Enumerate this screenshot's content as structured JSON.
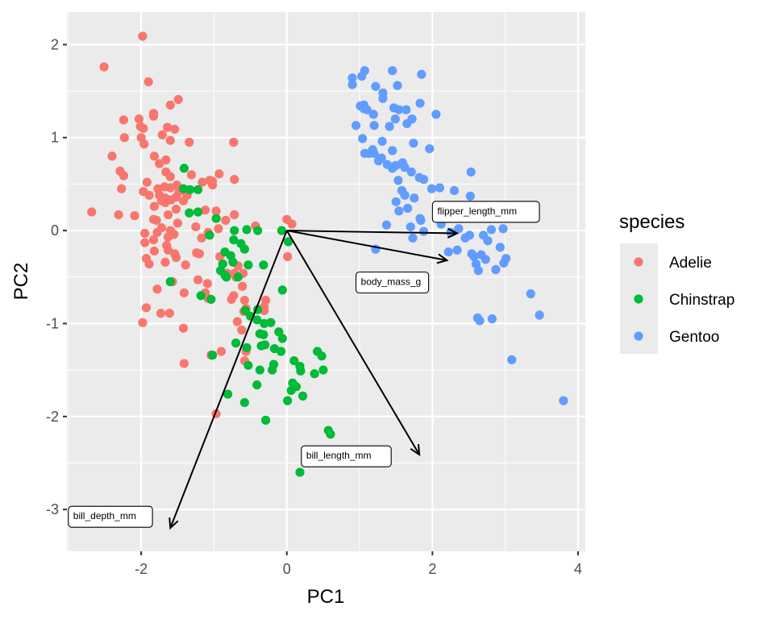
{
  "chart_data": {
    "type": "scatter",
    "title": "",
    "xlabel": "PC1",
    "ylabel": "PC2",
    "xlim": [
      -3.02,
      4.1
    ],
    "ylim": [
      -3.45,
      2.35
    ],
    "x_ticks": [
      -2,
      0,
      2,
      4
    ],
    "y_ticks": [
      -3,
      -2,
      -1,
      0,
      1,
      2
    ],
    "grid": true,
    "legend": {
      "title": "species",
      "position": "right"
    },
    "series": [
      {
        "name": "Adelie",
        "color": "#F8766D",
        "points": [
          [
            -1.98,
            2.09
          ],
          [
            -2.51,
            1.76
          ],
          [
            -1.9,
            1.6
          ],
          [
            -1.6,
            1.35
          ],
          [
            -1.49,
            1.41
          ],
          [
            -1.83,
            1.26
          ],
          [
            -1.83,
            1.23
          ],
          [
            -2.03,
            1.2
          ],
          [
            -2.24,
            1.19
          ],
          [
            -2.01,
            1.12
          ],
          [
            -1.97,
            1.1
          ],
          [
            -2.23,
            1.0
          ],
          [
            -2.0,
            1.0
          ],
          [
            -1.64,
            1.11
          ],
          [
            -1.54,
            1.09
          ],
          [
            -1.71,
            1.03
          ],
          [
            -1.6,
            0.97
          ],
          [
            -1.34,
            0.95
          ],
          [
            -0.73,
            0.95
          ],
          [
            -1.96,
            0.93
          ],
          [
            -1.82,
            0.8
          ],
          [
            -1.66,
            0.76
          ],
          [
            -2.4,
            0.8
          ],
          [
            -1.75,
            0.72
          ],
          [
            -2.29,
            0.64
          ],
          [
            -2.24,
            0.59
          ],
          [
            -1.66,
            0.63
          ],
          [
            -1.6,
            0.58
          ],
          [
            -1.92,
            0.52
          ],
          [
            -2.27,
            0.45
          ],
          [
            -1.97,
            0.42
          ],
          [
            -1.77,
            0.45
          ],
          [
            -1.68,
            0.47
          ],
          [
            -1.6,
            0.46
          ],
          [
            -1.51,
            0.49
          ],
          [
            -1.37,
            0.38
          ],
          [
            -1.48,
            0.42
          ],
          [
            -1.06,
            0.54
          ],
          [
            -1.02,
            0.53
          ],
          [
            -0.93,
            0.61
          ],
          [
            -1.02,
            0.49
          ],
          [
            -1.31,
            0.6
          ],
          [
            -1.16,
            0.52
          ],
          [
            -0.72,
            0.55
          ],
          [
            -2.68,
            0.2
          ],
          [
            -2.09,
            0.16
          ],
          [
            -2.31,
            0.17
          ],
          [
            -1.89,
            0.38
          ],
          [
            -1.75,
            0.38
          ],
          [
            -1.67,
            0.35
          ],
          [
            -1.82,
            0.26
          ],
          [
            -1.72,
            0.32
          ],
          [
            -1.67,
            0.3
          ],
          [
            -1.59,
            0.33
          ],
          [
            -1.52,
            0.36
          ],
          [
            -1.42,
            0.32
          ],
          [
            -1.83,
            0.12
          ],
          [
            -1.79,
            0.11
          ],
          [
            -1.52,
            0.23
          ],
          [
            -1.63,
            0.17
          ],
          [
            -1.12,
            0.22
          ],
          [
            -0.97,
            0.21
          ],
          [
            -0.72,
            0.17
          ],
          [
            -1.25,
            0.04
          ],
          [
            -0.84,
            0.11
          ],
          [
            -1.95,
            -0.03
          ],
          [
            -1.78,
            -0.02
          ],
          [
            -1.72,
            0.03
          ],
          [
            -1.6,
            0.0
          ],
          [
            -1.5,
            0.08
          ],
          [
            -1.95,
            -0.13
          ],
          [
            -1.83,
            -0.1
          ],
          [
            -1.63,
            -0.07
          ],
          [
            -1.55,
            -0.04
          ],
          [
            -1.17,
            -0.08
          ],
          [
            -1.08,
            -0.02
          ],
          [
            -0.94,
            0.02
          ],
          [
            -1.82,
            -0.22
          ],
          [
            -1.65,
            -0.16
          ],
          [
            -1.63,
            -0.21
          ],
          [
            -1.93,
            -0.3
          ],
          [
            -1.54,
            -0.25
          ],
          [
            -1.39,
            -0.37
          ],
          [
            -1.2,
            -0.25
          ],
          [
            -1.24,
            -0.24
          ],
          [
            -0.92,
            -0.28
          ],
          [
            -0.67,
            -0.38
          ],
          [
            -0.6,
            -0.46
          ],
          [
            -1.89,
            -0.36
          ],
          [
            -1.67,
            -0.34
          ],
          [
            -1.52,
            -0.29
          ],
          [
            -1.57,
            -0.55
          ],
          [
            -1.22,
            -0.53
          ],
          [
            -1.09,
            -0.57
          ],
          [
            -0.82,
            -0.46
          ],
          [
            -0.72,
            -0.46
          ],
          [
            -0.7,
            -0.5
          ],
          [
            -0.61,
            -0.6
          ],
          [
            -1.78,
            -0.63
          ],
          [
            -1.41,
            -0.67
          ],
          [
            -1.12,
            -0.67
          ],
          [
            -1.08,
            -0.73
          ],
          [
            -0.73,
            -0.7
          ],
          [
            -0.76,
            -0.74
          ],
          [
            -0.58,
            -0.75
          ],
          [
            -1.93,
            -0.83
          ],
          [
            -1.73,
            -0.89
          ],
          [
            -1.61,
            -0.89
          ],
          [
            -1.98,
            -0.99
          ],
          [
            -1.42,
            -1.05
          ],
          [
            -0.56,
            -0.84
          ],
          [
            -0.59,
            -0.87
          ],
          [
            -0.68,
            -0.98
          ],
          [
            -0.31,
            -0.82
          ],
          [
            -0.31,
            -0.86
          ],
          [
            -1.04,
            -1.34
          ],
          [
            -0.9,
            -1.3
          ],
          [
            -0.56,
            -1.3
          ],
          [
            -1.41,
            -1.43
          ],
          [
            -0.62,
            -1.07
          ],
          [
            -0.29,
            -0.75
          ],
          [
            -0.58,
            -1.4
          ],
          [
            -0.97,
            -1.97
          ],
          [
            0.0,
            0.12
          ],
          [
            0.07,
            0.07
          ],
          [
            0.01,
            -0.28
          ],
          [
            -0.43,
            0.05
          ]
        ]
      },
      {
        "name": "Chinstrap",
        "color": "#00BA38",
        "points": [
          [
            -1.41,
            0.67
          ],
          [
            -1.42,
            0.45
          ],
          [
            -1.22,
            0.44
          ],
          [
            -1.33,
            0.44
          ],
          [
            -1.34,
            0.19
          ],
          [
            -1.22,
            0.2
          ],
          [
            -0.97,
            0.13
          ],
          [
            -0.72,
            0.0
          ],
          [
            -0.55,
            0.01
          ],
          [
            -1.06,
            -0.05
          ],
          [
            -0.4,
            0.0
          ],
          [
            -0.73,
            -0.1
          ],
          [
            -0.07,
            0.0
          ],
          [
            -0.63,
            -0.14
          ],
          [
            -0.58,
            -0.2
          ],
          [
            -0.85,
            -0.23
          ],
          [
            -0.77,
            -0.27
          ],
          [
            -0.88,
            -0.36
          ],
          [
            -0.74,
            -0.34
          ],
          [
            -0.85,
            -0.48
          ],
          [
            -0.83,
            -0.5
          ],
          [
            -0.67,
            -0.5
          ],
          [
            0.02,
            -0.12
          ],
          [
            -0.32,
            -0.37
          ],
          [
            -0.53,
            -0.37
          ],
          [
            -1.6,
            -0.55
          ],
          [
            -1.18,
            -0.7
          ],
          [
            -1.04,
            -0.74
          ],
          [
            -0.57,
            -0.86
          ],
          [
            -0.4,
            -0.85
          ],
          [
            -0.06,
            -0.64
          ],
          [
            -0.5,
            -0.92
          ],
          [
            -0.41,
            -0.96
          ],
          [
            -0.31,
            -1.0
          ],
          [
            -0.37,
            -1.11
          ],
          [
            -0.22,
            -0.99
          ],
          [
            -0.11,
            -1.09
          ],
          [
            -0.06,
            -1.16
          ],
          [
            -0.32,
            -1.12
          ],
          [
            -0.35,
            -1.24
          ],
          [
            -0.3,
            -1.23
          ],
          [
            -0.55,
            -1.26
          ],
          [
            -0.53,
            -1.45
          ],
          [
            -0.17,
            -1.27
          ],
          [
            -0.08,
            -1.3
          ],
          [
            -0.18,
            -1.44
          ],
          [
            -0.37,
            -1.5
          ],
          [
            -0.2,
            -1.5
          ],
          [
            0.1,
            -1.4
          ],
          [
            0.18,
            -1.46
          ],
          [
            0.19,
            -1.51
          ],
          [
            0.42,
            -1.3
          ],
          [
            0.48,
            -1.35
          ],
          [
            0.38,
            -1.54
          ],
          [
            0.5,
            -1.5
          ],
          [
            0.08,
            -1.64
          ],
          [
            0.13,
            -1.68
          ],
          [
            0.06,
            -1.72
          ],
          [
            0.22,
            -1.78
          ],
          [
            0.01,
            -1.83
          ],
          [
            -0.41,
            -1.66
          ],
          [
            -0.58,
            -1.85
          ],
          [
            -1.02,
            -1.34
          ],
          [
            -0.81,
            -1.76
          ],
          [
            -0.29,
            -2.04
          ],
          [
            0.57,
            -2.15
          ],
          [
            0.6,
            -2.19
          ],
          [
            0.18,
            -2.6
          ],
          [
            -0.91,
            -0.43
          ],
          [
            -0.7,
            -1.21
          ]
        ]
      },
      {
        "name": "Gentoo",
        "color": "#619CFF",
        "points": [
          [
            0.9,
            1.64
          ],
          [
            1.07,
            1.72
          ],
          [
            1.45,
            1.72
          ],
          [
            1.03,
            1.66
          ],
          [
            1.85,
            1.68
          ],
          [
            1.22,
            1.55
          ],
          [
            0.9,
            1.57
          ],
          [
            1.52,
            1.56
          ],
          [
            1.06,
            1.35
          ],
          [
            1.32,
            1.48
          ],
          [
            1.01,
            1.34
          ],
          [
            1.06,
            1.31
          ],
          [
            1.1,
            1.3
          ],
          [
            1.19,
            1.25
          ],
          [
            1.32,
            1.42
          ],
          [
            1.83,
            1.37
          ],
          [
            1.47,
            1.32
          ],
          [
            1.54,
            1.3
          ],
          [
            1.64,
            1.3
          ],
          [
            1.49,
            1.2
          ],
          [
            1.65,
            1.15
          ],
          [
            1.72,
            1.2
          ],
          [
            1.2,
            1.13
          ],
          [
            0.95,
            1.13
          ],
          [
            1.41,
            1.12
          ],
          [
            2.05,
            1.25
          ],
          [
            1.04,
            0.99
          ],
          [
            1.13,
            0.83
          ],
          [
            1.31,
            0.96
          ],
          [
            1.45,
            0.86
          ],
          [
            1.74,
            0.94
          ],
          [
            1.96,
            0.88
          ],
          [
            1.5,
            0.7
          ],
          [
            1.59,
            0.73
          ],
          [
            1.62,
            0.68
          ],
          [
            1.71,
            0.63
          ],
          [
            1.53,
            0.54
          ],
          [
            1.82,
            0.57
          ],
          [
            1.2,
            0.83
          ],
          [
            1.3,
            0.78
          ],
          [
            1.38,
            0.71
          ],
          [
            1.45,
            0.67
          ],
          [
            1.48,
            0.69
          ],
          [
            1.26,
            0.75
          ],
          [
            1.18,
            0.87
          ],
          [
            1.07,
            0.83
          ],
          [
            1.88,
            0.55
          ],
          [
            1.99,
            0.45
          ],
          [
            2.1,
            0.46
          ],
          [
            2.3,
            0.43
          ],
          [
            2.53,
            0.63
          ],
          [
            2.52,
            0.37
          ],
          [
            2.67,
            0.22
          ],
          [
            2.45,
            0.18
          ],
          [
            1.58,
            0.43
          ],
          [
            1.62,
            0.38
          ],
          [
            1.75,
            0.35
          ],
          [
            1.5,
            0.31
          ],
          [
            1.54,
            0.21
          ],
          [
            1.66,
            0.24
          ],
          [
            1.83,
            0.13
          ],
          [
            1.84,
            0.11
          ],
          [
            2.12,
            0.07
          ],
          [
            2.36,
            0.02
          ],
          [
            2.25,
            -0.02
          ],
          [
            2.51,
            -0.05
          ],
          [
            2.45,
            -0.08
          ],
          [
            2.7,
            -0.05
          ],
          [
            2.81,
            0.01
          ],
          [
            2.76,
            -0.11
          ],
          [
            2.97,
            0.02
          ],
          [
            1.7,
            0.04
          ],
          [
            1.88,
            -0.01
          ],
          [
            1.73,
            -0.08
          ],
          [
            1.37,
            0.06
          ],
          [
            2.34,
            -0.21
          ],
          [
            2.54,
            -0.25
          ],
          [
            2.57,
            -0.28
          ],
          [
            2.67,
            -0.26
          ],
          [
            2.73,
            -0.31
          ],
          [
            2.93,
            -0.18
          ],
          [
            2.98,
            -0.35
          ],
          [
            1.22,
            -0.2
          ],
          [
            2.22,
            -0.23
          ],
          [
            2.6,
            -0.36
          ],
          [
            3.01,
            -0.3
          ],
          [
            2.87,
            -0.42
          ],
          [
            3.35,
            -0.68
          ],
          [
            3.47,
            -0.91
          ],
          [
            2.62,
            -0.94
          ],
          [
            2.65,
            -0.97
          ],
          [
            2.82,
            -0.95
          ],
          [
            3.09,
            -1.39
          ],
          [
            3.8,
            -1.83
          ],
          [
            2.63,
            -0.43
          ]
        ]
      }
    ],
    "loadings": [
      {
        "name": "flipper_length_mm",
        "x": 2.34,
        "y": -0.03,
        "label_x": 2.0,
        "label_y": 0.21
      },
      {
        "name": "body_mass_g",
        "x": 2.2,
        "y": -0.32,
        "label_x": 0.95,
        "label_y": -0.55
      },
      {
        "name": "bill_length_mm",
        "x": 1.82,
        "y": -2.41,
        "label_x": 0.2,
        "label_y": -2.42
      },
      {
        "name": "bill_depth_mm",
        "x": -1.6,
        "y": -3.2,
        "label_x": -3.0,
        "label_y": -3.07
      }
    ]
  }
}
